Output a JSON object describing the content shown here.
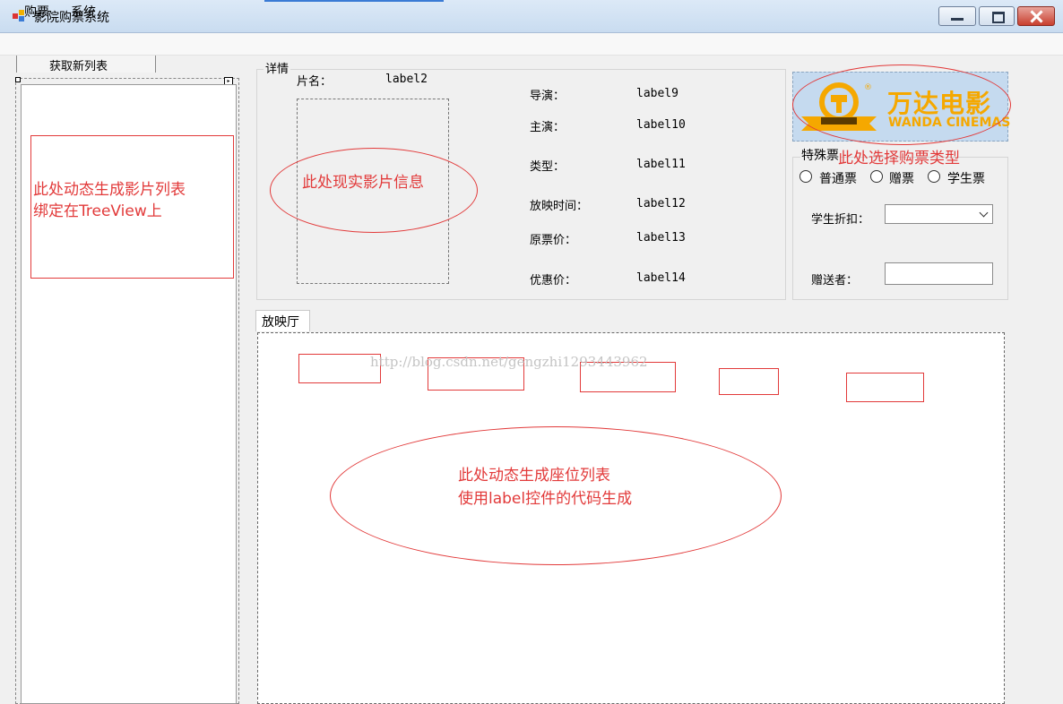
{
  "window": {
    "title": "影院购票系统",
    "buttons": {
      "minimize": "minimize",
      "maximize": "maximize",
      "close": "close"
    }
  },
  "menu": [
    "购票",
    "系统"
  ],
  "left": {
    "refresh_button": "获取新列表",
    "annotation": "此处动态生成影片列表\n绑定在TreeView上"
  },
  "details": {
    "title": "详情",
    "name_label": "片名：",
    "name_value": "label2",
    "fields": [
      {
        "label": "导演：",
        "value": "label9"
      },
      {
        "label": "主演：",
        "value": "label10"
      },
      {
        "label": "类型：",
        "value": "label11"
      },
      {
        "label": "放映时间：",
        "value": "label12"
      },
      {
        "label": "原票价：",
        "value": "label13"
      },
      {
        "label": "优惠价：",
        "value": "label14"
      }
    ],
    "annotation": "此处现实影片信息"
  },
  "logo": {
    "cn": "万达电影",
    "en": "WANDA CINEMAS"
  },
  "special": {
    "title": "特殊票",
    "annotation": "此处选择购票类型",
    "options": [
      "普通票",
      "赠票",
      "学生票"
    ],
    "discount_label": "学生折扣：",
    "discount_value": "",
    "giver_label": "赠送者：",
    "giver_value": ""
  },
  "hall": {
    "tab": "放映厅",
    "watermark": "http://blog.csdn.net/gengzhi1293443962",
    "annotation": "此处动态生成座位列表\n使用label控件的代码生成"
  },
  "colors": {
    "annotation": "#e23a3a",
    "logo": "#f5a800",
    "logo_bg": "#c5daef"
  }
}
